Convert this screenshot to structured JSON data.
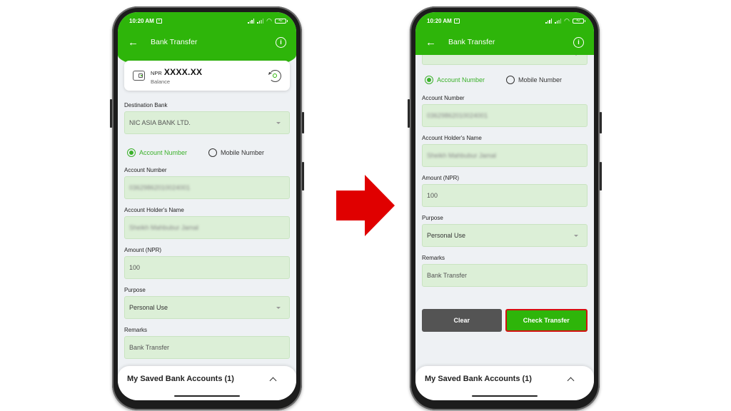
{
  "status_bar": {
    "time": "10:20 AM",
    "battery": "42"
  },
  "app_bar": {
    "title": "Bank Transfer"
  },
  "balance": {
    "currency": "NPR",
    "amount": "XXXX.XX",
    "label": "Balance"
  },
  "form": {
    "destination_bank": {
      "label": "Destination Bank",
      "value": "NIC ASIA BANK LTD."
    },
    "account_type": {
      "options": [
        "Account Number",
        "Mobile Number"
      ],
      "selected": "Account Number"
    },
    "account_number": {
      "label": "Account Number",
      "value": "03629862010024001"
    },
    "account_holder": {
      "label": "Account Holder's Name",
      "value": "Sheikh Mahbubur Jamal"
    },
    "amount": {
      "label": "Amount (NPR)",
      "value": "100"
    },
    "purpose": {
      "label": "Purpose",
      "value": "Personal Use"
    },
    "remarks": {
      "label": "Remarks",
      "value": "Bank Transfer"
    }
  },
  "actions": {
    "clear_label": "Clear",
    "check_label": "Check Transfer"
  },
  "saved_accounts": {
    "title": "My Saved Bank Accounts (1)"
  },
  "colors": {
    "brand_green": "#2eb50a",
    "field_bg": "#dcefd7",
    "highlight_red": "#d41010",
    "arrow_red": "#e00000"
  }
}
